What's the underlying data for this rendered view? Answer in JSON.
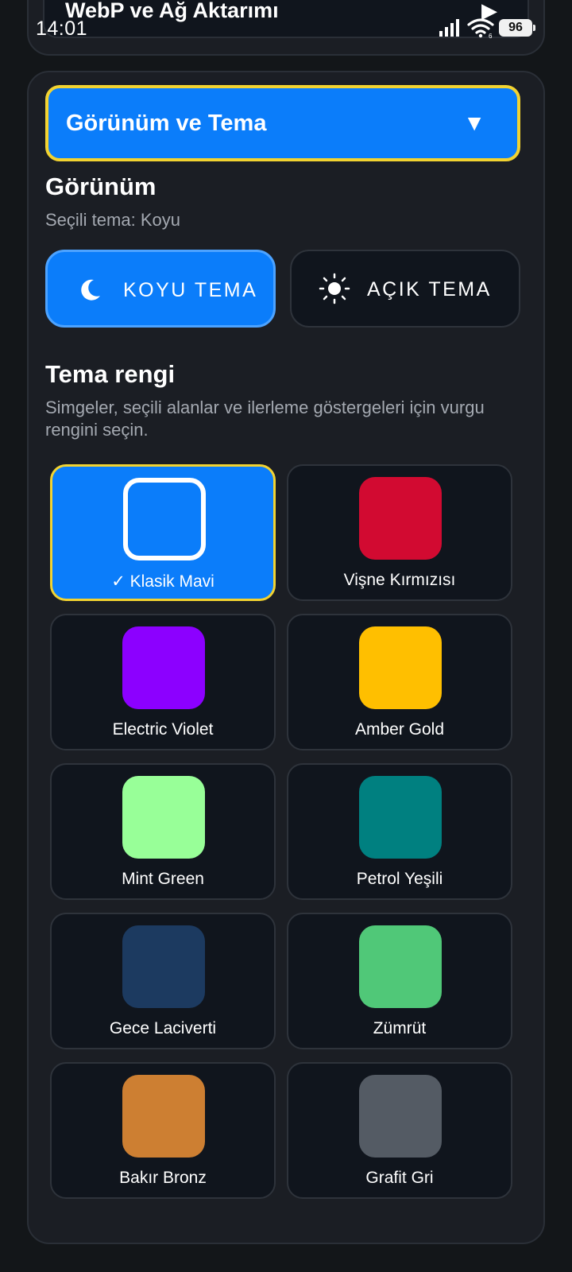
{
  "prev_section": {
    "title": "WebP ve Ağ Aktarımı"
  },
  "status_bar": {
    "time": "14:01",
    "battery": "96"
  },
  "section": {
    "dropdown_label": "Görünüm ve Tema",
    "appearance_title": "Görünüm",
    "selected_theme_text": "Seçili tema: Koyu",
    "dark_button": "KOYU TEMA",
    "light_button": "AÇIK TEMA",
    "accent_title": "Tema rengi",
    "accent_description": "Simgeler, seçili alanlar ve ilerleme göstergeleri için vurgu rengini seçin."
  },
  "accent_colors": [
    {
      "label": "✓ Klasik Mavi",
      "color": "#0b7dfa",
      "selected": true
    },
    {
      "label": "Vişne Kırmızısı",
      "color": "#d20a31",
      "selected": false
    },
    {
      "label": "Electric Violet",
      "color": "#8c00ff",
      "selected": false
    },
    {
      "label": "Amber Gold",
      "color": "#ffbf00",
      "selected": false
    },
    {
      "label": "Mint Green",
      "color": "#98ff98",
      "selected": false
    },
    {
      "label": "Petrol Yeşili",
      "color": "#008080",
      "selected": false
    },
    {
      "label": "Gece Laciverti",
      "color": "#1c3a60",
      "selected": false
    },
    {
      "label": "Zümrüt",
      "color": "#50c878",
      "selected": false
    },
    {
      "label": "Bakır Bronz",
      "color": "#cd7f32",
      "selected": false
    },
    {
      "label": "Grafit Gri",
      "color": "#545b64",
      "selected": false
    }
  ]
}
